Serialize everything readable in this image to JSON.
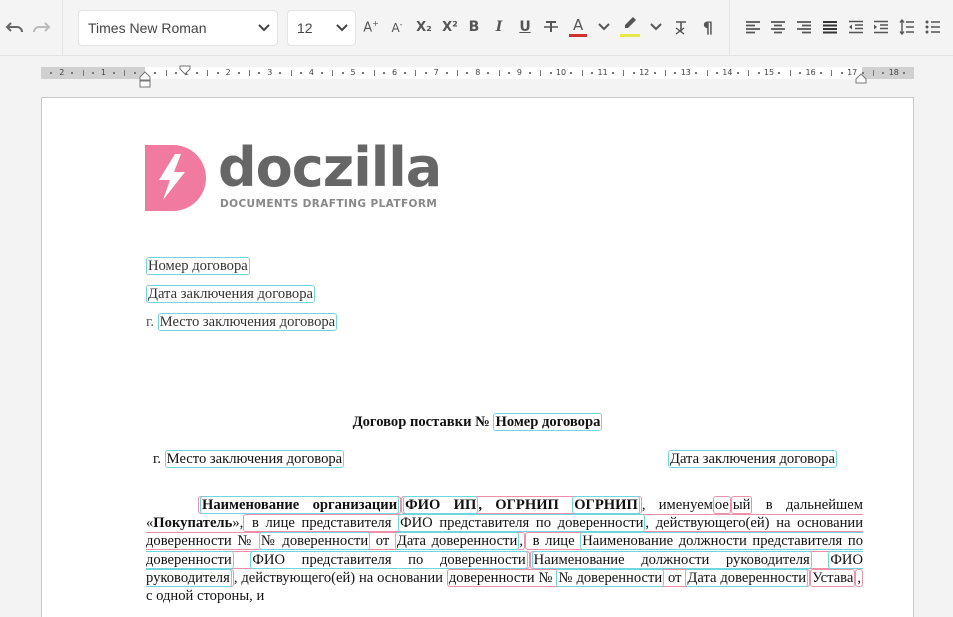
{
  "toolbar": {
    "font_family": "Times New Roman",
    "font_size": "12",
    "buttons": {
      "undo": "undo-icon",
      "redo": "redo-icon",
      "increase_font": "font-increase-icon",
      "decrease_font": "font-decrease-icon",
      "subscript": "subscript-icon",
      "superscript": "superscript-icon",
      "bold": "bold-icon",
      "italic": "italic-icon",
      "underline": "underline-icon",
      "strikethrough": "strikethrough-icon",
      "text_color": "text-color-icon",
      "highlight": "highlight-icon",
      "clear_format": "clear-format-icon",
      "pilcrow": "pilcrow-icon",
      "align_left": "align-left-icon",
      "align_center": "align-center-icon",
      "align_right": "align-right-icon",
      "justify": "justify-icon",
      "outdent": "outdent-icon",
      "indent": "indent-icon",
      "line_spacing": "line-spacing-icon",
      "bullet_list": "bullet-list-icon"
    },
    "glyphs": {
      "text_color_letter": "A",
      "subscript": "X₂",
      "superscript": "X²",
      "bold": "B",
      "italic": "I",
      "underline": "U",
      "pilcrow": "¶"
    },
    "colors": {
      "text_color_bar": "#d32f2f",
      "highlight_bar": "#e8e84a"
    }
  },
  "ruler": {
    "left_numbers": [
      "2",
      "1"
    ],
    "right_numbers": [
      "1",
      "2",
      "3",
      "4",
      "5",
      "6",
      "7",
      "8",
      "9",
      "10",
      "11",
      "12",
      "13",
      "14",
      "15",
      "16",
      "17",
      "18"
    ]
  },
  "logo": {
    "name": "doczilla",
    "tagline": "DOCUMENTS DRAFTING PLATFORM",
    "brand_color": "#f07aa0"
  },
  "document": {
    "header": {
      "contract_number": "Номер договора",
      "contract_date": "Дата заключения договора",
      "place_prefix": "г.",
      "place": "Место заключения договора"
    },
    "title_prefix": "Договор поставки №",
    "title_placeholder": "Номер договора",
    "place_line_prefix": "г.",
    "place_line": "Место заключения договора",
    "date_line": "Дата заключения договора",
    "para": {
      "org_name": "Наименование организации",
      "fio_ip": "ФИО ИП",
      "ogrnip_label": ", ОГРНИП ",
      "ogrnip": "ОГРНИП",
      "named_text": ", именуем",
      "ending_1": "ое",
      "ending_2": "ый",
      "further_text": " в дальнейшем «",
      "buyer": "Покупатель",
      "after_buyer": "»,",
      "in_person": " в лице представителя ",
      "rep_fio": "ФИО представителя по доверенности",
      "acting_text": ", действующего(ей) на основании доверенности № ",
      "poa_number": "№ доверенности",
      "from_text": " от ",
      "poa_date": "Дата доверенности",
      "comma_mark": ",",
      "in_person_2": " в лице ",
      "rep_position": "Наименование должности представителя по доверенности",
      "rep_fio_2": "ФИО представителя по доверенности",
      "head_position": "Наименование должности руководителя",
      "head_fio": "ФИО руководителя",
      "acting_text_2": ", действующего(ей) на основании ",
      "poa_prefix_2": "доверенности № ",
      "poa_number_2": "№ доверенности",
      "from_text_2": " от ",
      "poa_date_2": "Дата доверенности",
      "charter": "Устава",
      "comma_mark_2": ",",
      "end_text": " с одной стороны, и"
    }
  }
}
